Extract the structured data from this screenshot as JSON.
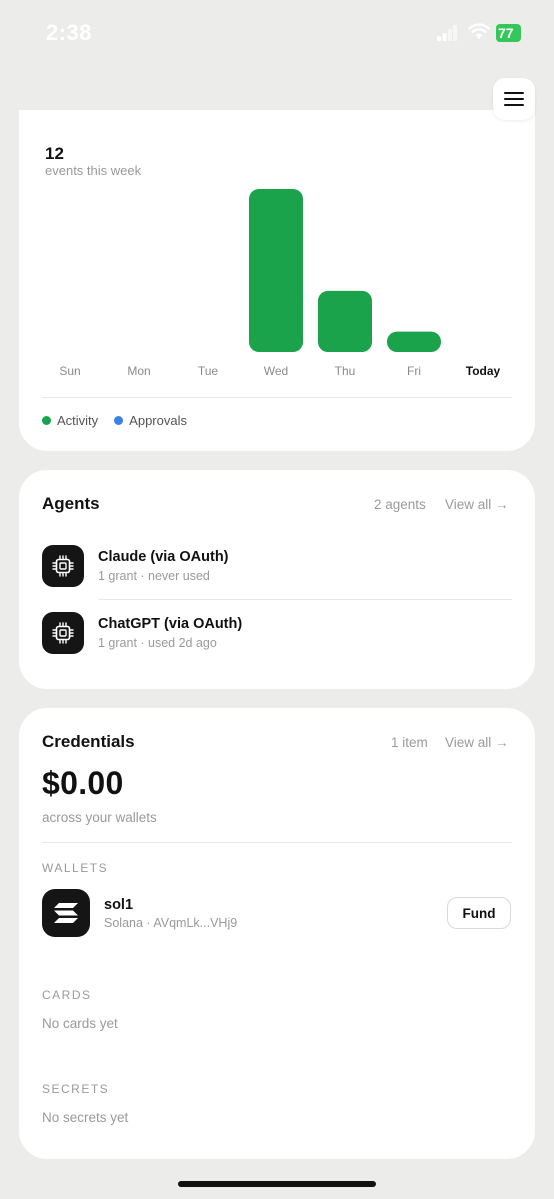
{
  "status": {
    "time": "2:38",
    "battery": "77"
  },
  "colors": {
    "activity": "#1aa34a",
    "approvals": "#3b82e6"
  },
  "activity": {
    "count": "12",
    "count_label": "events this week",
    "chart_data": {
      "type": "bar",
      "categories": [
        "Sun",
        "Mon",
        "Tue",
        "Wed",
        "Thu",
        "Fri",
        "Today"
      ],
      "highlight": "Today",
      "series": [
        {
          "name": "Activity",
          "values": [
            0,
            0,
            0,
            8,
            3,
            1,
            0
          ]
        },
        {
          "name": "Approvals",
          "values": [
            0,
            0,
            0,
            0,
            0,
            0,
            0
          ]
        }
      ]
    },
    "legend": [
      "Activity",
      "Approvals"
    ]
  },
  "agents": {
    "title": "Agents",
    "count": "2 agents",
    "view_all": "View all →",
    "items": [
      {
        "name": "Claude (via OAuth)",
        "sub": "1 grant · never used",
        "icon": "chip-icon"
      },
      {
        "name": "ChatGPT (via OAuth)",
        "sub": "1 grant · used 2d ago",
        "icon": "chip-icon"
      }
    ]
  },
  "credentials": {
    "title": "Credentials",
    "count": "1 item",
    "view_all": "View all →",
    "balance": "$0.00",
    "balance_sub": "across your wallets",
    "wallets_label": "WALLETS",
    "wallet": {
      "name": "sol1",
      "sub": "Solana · AVqmLk...VHj9",
      "icon": "solana-icon",
      "action": "Fund"
    },
    "cards_label": "CARDS",
    "cards_empty": "No cards yet",
    "secrets_label": "SECRETS",
    "secrets_empty": "No secrets yet"
  }
}
